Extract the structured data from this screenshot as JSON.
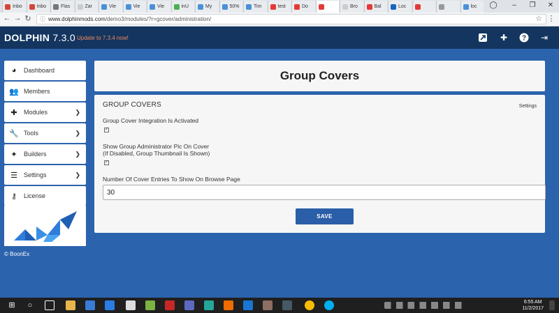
{
  "browser": {
    "tabs": [
      {
        "label": "Inbo",
        "color": "#d44638"
      },
      {
        "label": "Inbo",
        "color": "#d44638"
      },
      {
        "label": "Flas",
        "color": "#777777"
      },
      {
        "label": "Zar",
        "color": "#cccccc"
      },
      {
        "label": "Vie",
        "color": "#4a90d9"
      },
      {
        "label": "Vie",
        "color": "#4a90d9"
      },
      {
        "label": "Vie",
        "color": "#4a90d9"
      },
      {
        "label": "inU",
        "color": "#4caf50"
      },
      {
        "label": "My",
        "color": "#4a90d9"
      },
      {
        "label": "50%",
        "color": "#4a90d9"
      },
      {
        "label": "Tim",
        "color": "#4a90d9"
      },
      {
        "label": "test",
        "color": "#e53935"
      },
      {
        "label": "Do",
        "color": "#e53935"
      },
      {
        "label": "",
        "color": "#e53935"
      },
      {
        "label": "Bro",
        "color": "#cccccc"
      },
      {
        "label": "Bal",
        "color": "#e53935"
      },
      {
        "label": "Loc",
        "color": "#1565c0"
      },
      {
        "label": "",
        "color": "#e53935"
      },
      {
        "label": "",
        "color": "#999999"
      },
      {
        "label": "loc",
        "color": "#4a90d9"
      }
    ],
    "url_domain": "www.dolphinmods.com",
    "url_path": "/demo3/modules/?r=gcover/administration/"
  },
  "header": {
    "brand": "DOLPHIN",
    "version": "7.3.0",
    "update": "Update to 7.3.4 now!"
  },
  "sidebar": {
    "items": [
      {
        "label": "Dashboard",
        "icon": "dashboard-icon",
        "glyph": "◕",
        "has_chevron": false
      },
      {
        "label": "Members",
        "icon": "users-icon",
        "glyph": "👥",
        "has_chevron": false
      },
      {
        "label": "Modules",
        "icon": "puzzle-icon",
        "glyph": "✚",
        "has_chevron": true
      },
      {
        "label": "Tools",
        "icon": "wrench-icon",
        "glyph": "🔧",
        "has_chevron": true
      },
      {
        "label": "Builders",
        "icon": "magic-icon",
        "glyph": "✦",
        "has_chevron": true
      },
      {
        "label": "Settings",
        "icon": "sliders-icon",
        "glyph": "☰",
        "has_chevron": true
      },
      {
        "label": "License",
        "icon": "key-icon",
        "glyph": "⚷",
        "has_chevron": false
      }
    ],
    "copyright": "© BoonEx"
  },
  "main": {
    "title": "Group Covers",
    "section_title": "GROUP COVERS",
    "settings_link": "Settings",
    "fields": {
      "integration_label": "Group Cover Integration Is Activated",
      "integration_checked": true,
      "admin_pic_label_line1": "Show Group Administrator Pic On Cover",
      "admin_pic_label_line2": "(If Disabled, Group Thumbnail Is Shown)",
      "admin_pic_checked": true,
      "count_label": "Number Of Cover Entries To Show On Browse Page",
      "count_value": "30"
    },
    "save_label": "SAVE"
  },
  "taskbar": {
    "time": "6:55 AM",
    "date": "11/2/2017"
  },
  "colors": {
    "page_bg": "#2b63ad",
    "header_bg": "#13355f",
    "accent": "#2a5ea8",
    "update_text": "#f08a5d"
  }
}
